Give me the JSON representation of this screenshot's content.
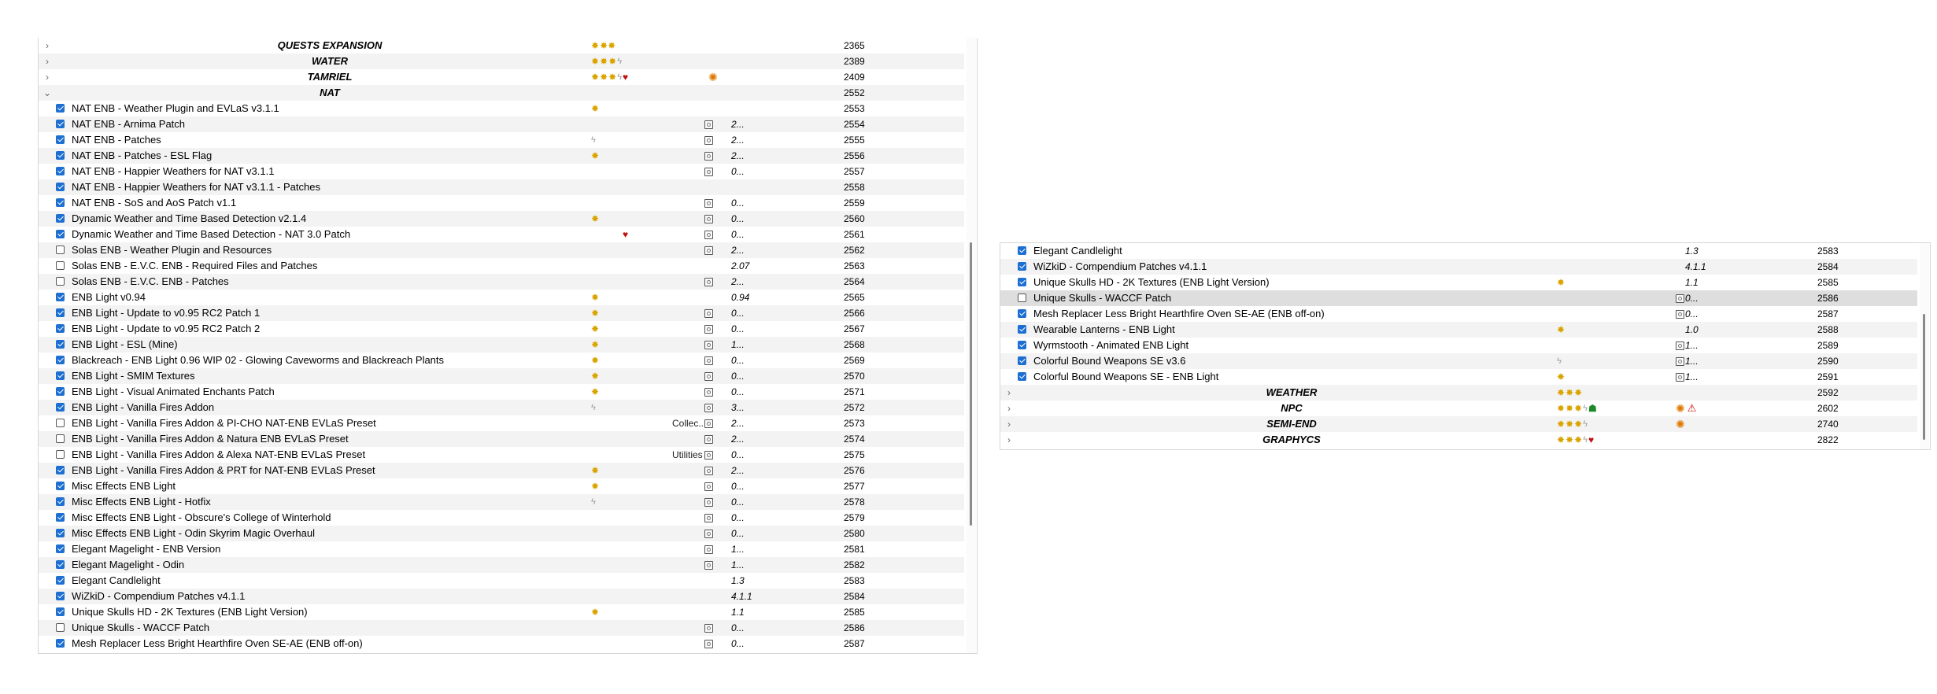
{
  "left_panel": {
    "rows": [
      {
        "type": "separator",
        "name": "QUESTS EXPANSION",
        "flags": [
          "star",
          "star-double"
        ],
        "contents": [],
        "priority": "2365"
      },
      {
        "type": "separator",
        "name": "WATER",
        "flags": [
          "star",
          "star",
          "star",
          "bolt"
        ],
        "contents": [],
        "priority": "2389"
      },
      {
        "type": "separator",
        "name": "TAMRIEL",
        "flags": [
          "star",
          "star",
          "star",
          "bolt",
          "heart"
        ],
        "contents": [
          "burst"
        ],
        "priority": "2409"
      },
      {
        "type": "separator",
        "name": "NAT",
        "expanded": true,
        "flags": [],
        "contents": [],
        "priority": "2552"
      },
      {
        "type": "mod",
        "checked": true,
        "name": "NAT ENB - Weather Plugin and EVLaS v3.1.1",
        "flags": [
          "star"
        ],
        "notes": false,
        "version": "",
        "priority": "2553"
      },
      {
        "type": "mod",
        "checked": true,
        "name": "NAT ENB - Arnima Patch",
        "flags": [],
        "notes": true,
        "version": "2...",
        "priority": "2554"
      },
      {
        "type": "mod",
        "checked": true,
        "name": "NAT ENB - Patches",
        "flags": [
          "bolt"
        ],
        "notes": true,
        "version": "2...",
        "priority": "2555"
      },
      {
        "type": "mod",
        "checked": true,
        "name": "NAT ENB - Patches - ESL Flag",
        "flags": [
          "star"
        ],
        "notes": true,
        "version": "2...",
        "priority": "2556"
      },
      {
        "type": "mod",
        "checked": true,
        "name": "NAT ENB - Happier Weathers for NAT v3.1.1",
        "flags": [],
        "notes": true,
        "version": "0...",
        "priority": "2557"
      },
      {
        "type": "mod",
        "checked": true,
        "name": "NAT ENB - Happier Weathers for NAT v3.1.1 - Patches",
        "flags": [],
        "notes": false,
        "version": "",
        "priority": "2558"
      },
      {
        "type": "mod",
        "checked": true,
        "name": "NAT ENB - SoS and AoS Patch v1.1",
        "flags": [],
        "notes": true,
        "version": "0...",
        "priority": "2559"
      },
      {
        "type": "mod",
        "checked": true,
        "name": "Dynamic Weather and Time Based Detection v2.1.4",
        "flags": [
          "star"
        ],
        "notes": true,
        "version": "0...",
        "priority": "2560"
      },
      {
        "type": "mod",
        "checked": true,
        "name": "Dynamic Weather and Time Based Detection - NAT 3.0 Patch",
        "flags": [
          "spacer",
          "spacer",
          "spacer",
          "spacer",
          "heart"
        ],
        "notes": true,
        "version": "0...",
        "priority": "2561"
      },
      {
        "type": "mod",
        "checked": false,
        "name": "Solas ENB - Weather Plugin and Resources",
        "flags": [],
        "notes": true,
        "version": "2...",
        "priority": "2562"
      },
      {
        "type": "mod",
        "checked": false,
        "name": "Solas ENB - E.V.C. ENB - Required Files and Patches",
        "flags": [],
        "notes": false,
        "version": "2.07",
        "priority": "2563"
      },
      {
        "type": "mod",
        "checked": false,
        "name": "Solas ENB - E.V.C. ENB - Patches",
        "flags": [],
        "notes": true,
        "version": "2...",
        "priority": "2564"
      },
      {
        "type": "mod",
        "checked": true,
        "name": "ENB Light v0.94",
        "flags": [
          "star"
        ],
        "notes": false,
        "version": "0.94",
        "priority": "2565"
      },
      {
        "type": "mod",
        "checked": true,
        "name": "ENB Light - Update to v0.95 RC2 Patch 1",
        "flags": [
          "star"
        ],
        "notes": true,
        "version": "0...",
        "priority": "2566"
      },
      {
        "type": "mod",
        "checked": true,
        "name": "ENB Light - Update to v0.95 RC2 Patch 2",
        "flags": [
          "star"
        ],
        "notes": true,
        "version": "0...",
        "priority": "2567"
      },
      {
        "type": "mod",
        "checked": true,
        "name": "ENB Light - ESL (Mine)",
        "flags": [
          "star"
        ],
        "notes": true,
        "version": "1...",
        "priority": "2568"
      },
      {
        "type": "mod",
        "checked": true,
        "name": "Blackreach - ENB Light 0.96 WIP 02 - Glowing Caveworms and Blackreach Plants",
        "flags": [
          "star"
        ],
        "notes": true,
        "version": "0...",
        "priority": "2569"
      },
      {
        "type": "mod",
        "checked": true,
        "name": "ENB Light - SMIM Textures",
        "flags": [
          "star"
        ],
        "notes": true,
        "version": "0...",
        "priority": "2570"
      },
      {
        "type": "mod",
        "checked": true,
        "name": "ENB Light - Visual Animated Enchants Patch",
        "flags": [
          "star"
        ],
        "notes": true,
        "version": "0...",
        "priority": "2571"
      },
      {
        "type": "mod",
        "checked": true,
        "name": "ENB Light - Vanilla Fires Addon",
        "flags": [
          "bolt"
        ],
        "notes": true,
        "version": "3...",
        "priority": "2572"
      },
      {
        "type": "mod",
        "checked": false,
        "name": "ENB Light - Vanilla Fires Addon & PI-CHO NAT-ENB EVLaS Preset",
        "flags": [],
        "category": "Collec...",
        "notes": true,
        "version": "2...",
        "priority": "2573"
      },
      {
        "type": "mod",
        "checked": false,
        "name": "ENB Light - Vanilla Fires Addon & Natura ENB EVLaS Preset",
        "flags": [],
        "notes": true,
        "version": "2...",
        "priority": "2574"
      },
      {
        "type": "mod",
        "checked": false,
        "name": "ENB Light - Vanilla Fires Addon & Alexa NAT-ENB EVLaS Preset",
        "flags": [],
        "category": "Utilities",
        "notes": true,
        "version": "0...",
        "priority": "2575"
      },
      {
        "type": "mod",
        "checked": true,
        "name": "ENB Light - Vanilla Fires Addon & PRT for NAT-ENB EVLaS Preset",
        "flags": [
          "star"
        ],
        "notes": true,
        "version": "2...",
        "priority": "2576"
      },
      {
        "type": "mod",
        "checked": true,
        "name": "Misc Effects ENB Light",
        "flags": [
          "star"
        ],
        "notes": true,
        "version": "0...",
        "priority": "2577"
      },
      {
        "type": "mod",
        "checked": true,
        "name": "Misc Effects ENB Light - Hotfix",
        "flags": [
          "bolt"
        ],
        "notes": true,
        "version": "0...",
        "priority": "2578"
      },
      {
        "type": "mod",
        "checked": true,
        "name": "Misc Effects ENB Light - Obscure's College of Winterhold",
        "flags": [],
        "notes": true,
        "version": "0...",
        "priority": "2579"
      },
      {
        "type": "mod",
        "checked": true,
        "name": "Misc Effects ENB Light - Odin Skyrim Magic Overhaul",
        "flags": [],
        "notes": true,
        "version": "0...",
        "priority": "2580"
      },
      {
        "type": "mod",
        "checked": true,
        "name": "Elegant Magelight - ENB Version",
        "flags": [],
        "notes": true,
        "version": "1...",
        "priority": "2581"
      },
      {
        "type": "mod",
        "checked": true,
        "name": "Elegant Magelight - Odin",
        "flags": [],
        "notes": true,
        "version": "1...",
        "priority": "2582"
      },
      {
        "type": "mod",
        "checked": true,
        "name": "Elegant Candlelight",
        "flags": [],
        "notes": false,
        "version": "1.3",
        "priority": "2583"
      },
      {
        "type": "mod",
        "checked": true,
        "name": "WiZkiD - Compendium Patches v4.1.1",
        "flags": [],
        "notes": false,
        "version": "4.1.1",
        "priority": "2584"
      },
      {
        "type": "mod",
        "checked": true,
        "name": "Unique Skulls HD - 2K Textures (ENB Light Version)",
        "flags": [
          "star"
        ],
        "notes": false,
        "version": "1.1",
        "priority": "2585"
      },
      {
        "type": "mod",
        "checked": false,
        "name": "Unique Skulls - WACCF Patch",
        "flags": [],
        "notes": true,
        "version": "0...",
        "priority": "2586"
      },
      {
        "type": "mod",
        "checked": true,
        "name": "Mesh Replacer Less Bright Hearthfire Oven SE-AE (ENB off-on)",
        "flags": [],
        "notes": true,
        "version": "0...",
        "priority": "2587"
      }
    ]
  },
  "right_panel": {
    "rows": [
      {
        "type": "mod",
        "checked": true,
        "name": "Elegant Candlelight",
        "flags": [],
        "notes": false,
        "version": "1.3",
        "priority": "2583"
      },
      {
        "type": "mod",
        "checked": true,
        "name": "WiZkiD - Compendium Patches v4.1.1",
        "flags": [],
        "notes": false,
        "version": "4.1.1",
        "priority": "2584"
      },
      {
        "type": "mod",
        "checked": true,
        "name": "Unique Skulls HD - 2K Textures (ENB Light Version)",
        "flags": [
          "star"
        ],
        "notes": false,
        "version": "1.1",
        "priority": "2585"
      },
      {
        "type": "mod",
        "checked": false,
        "selected": true,
        "name": "Unique Skulls - WACCF Patch",
        "flags": [],
        "notes": true,
        "version": "0...",
        "priority": "2586"
      },
      {
        "type": "mod",
        "checked": true,
        "name": "Mesh Replacer Less Bright Hearthfire Oven SE-AE (ENB off-on)",
        "flags": [],
        "notes": true,
        "version": "0...",
        "priority": "2587"
      },
      {
        "type": "mod",
        "checked": true,
        "name": "Wearable Lanterns - ENB Light",
        "flags": [
          "star"
        ],
        "notes": false,
        "version": "1.0",
        "priority": "2588"
      },
      {
        "type": "mod",
        "checked": true,
        "name": "Wyrmstooth - Animated ENB Light",
        "flags": [],
        "notes": true,
        "version": "1...",
        "priority": "2589"
      },
      {
        "type": "mod",
        "checked": true,
        "name": "Colorful Bound Weapons SE v3.6",
        "flags": [
          "bolt"
        ],
        "notes": true,
        "version": "1...",
        "priority": "2590"
      },
      {
        "type": "mod",
        "checked": true,
        "name": "Colorful Bound Weapons SE - ENB Light",
        "flags": [
          "star"
        ],
        "notes": true,
        "version": "1...",
        "priority": "2591"
      },
      {
        "type": "separator",
        "name": "WEATHER",
        "flags": [
          "star",
          "star",
          "star"
        ],
        "contents": [],
        "priority": "2592"
      },
      {
        "type": "separator",
        "name": "NPC",
        "flags": [
          "star",
          "star",
          "star",
          "bolt",
          "mask"
        ],
        "contents": [
          "burst",
          "warn"
        ],
        "priority": "2602"
      },
      {
        "type": "separator",
        "name": "SEMI-END",
        "flags": [
          "star",
          "star",
          "star",
          "bolt"
        ],
        "contents": [
          "burst"
        ],
        "priority": "2740"
      },
      {
        "type": "separator",
        "name": "GRAPHYCS",
        "flags": [
          "star",
          "star",
          "star",
          "bolt",
          "heart"
        ],
        "contents": [],
        "priority": "2822"
      }
    ]
  },
  "icons": {
    "star": "star-flag-icon",
    "star-double": "star-flag-icon",
    "bolt": "lightning-flag-icon",
    "heart": "heart-flag-icon",
    "mask": "mask-flag-icon",
    "burst": "burst-content-icon",
    "warn": "warning-icon",
    "notes": "notes-icon"
  },
  "colors": {
    "checkbox_checked": "#1d6fd1",
    "row_alt": "#f3f3f3",
    "row_selected": "#dedede",
    "warning": "#d00000",
    "burst": "#e07800"
  }
}
